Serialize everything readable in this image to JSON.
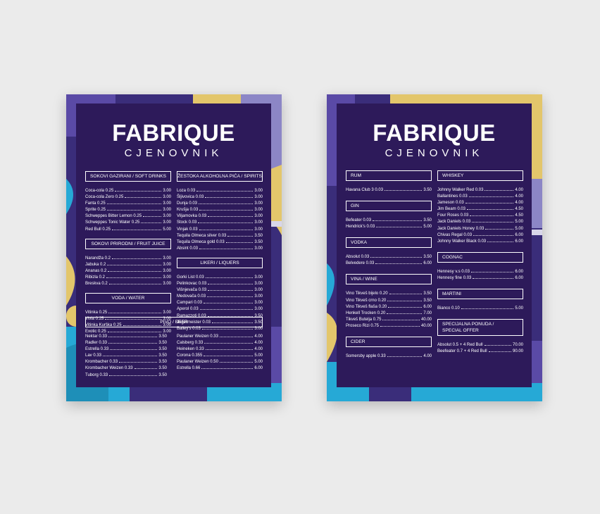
{
  "colors": {
    "background": "#ebebeb",
    "panel": "#2d1a5a",
    "purple": "#3a2d7a",
    "yellow": "#e3c66b",
    "blue": "#26a9d6",
    "lavender": "#8c86c6"
  },
  "left_menu": {
    "title": "FABRIQUE",
    "subtitle": "CJENOVNIK",
    "soft_drinks": {
      "header": "SOKOVI GAZIRANI / SOFT DRINKS",
      "items": [
        {
          "name": "Coca-cola 0.25",
          "price": "3.00"
        },
        {
          "name": "Coca-cola Zero 0.25",
          "price": "3.00"
        },
        {
          "name": "Fanta 0.25",
          "price": "3.00"
        },
        {
          "name": "Sprite 0.25",
          "price": "3.00"
        },
        {
          "name": "Schweppes Bitter Lemon 0.25",
          "price": "3.00"
        },
        {
          "name": "Schweppes Tonic Water 0.25",
          "price": "3.00"
        },
        {
          "name": "Red Bull 0.25",
          "price": "5.00"
        }
      ]
    },
    "fruit_juice": {
      "header": "SOKOVI PRIRODNI / FRUIT JUICE",
      "items": [
        {
          "name": "Narandža 0.2",
          "price": "3.00"
        },
        {
          "name": "Jabuka 0.2",
          "price": "3.00"
        },
        {
          "name": "Ananas 0.2",
          "price": "3.00"
        },
        {
          "name": "Ribizla 0.2",
          "price": "3.00"
        },
        {
          "name": "Breskva 0.2",
          "price": "3.00"
        }
      ]
    },
    "water": {
      "header": "VODA / WATER",
      "items": [
        {
          "name": "Vitinka 0.25",
          "price": "3.00"
        },
        {
          "name": "Vivia 0.25",
          "price": "3.00"
        },
        {
          "name": "Vitinka Kurška 0.25",
          "price": "3.00"
        },
        {
          "name": "Exotic 0.25",
          "price": "3.00"
        }
      ]
    },
    "spirits": {
      "header": "ŽESTOKA ALKOHOLNA PIĆA / SPIRITS",
      "items": [
        {
          "name": "Loza 0.03",
          "price": "3.00"
        },
        {
          "name": "Šljivovica 0.03",
          "price": "3.00"
        },
        {
          "name": "Dunja 0.03",
          "price": "3.00"
        },
        {
          "name": "Krušja 0.03",
          "price": "3.00"
        },
        {
          "name": "Viljamovka 0.03",
          "price": "3.00"
        },
        {
          "name": "Stock 0.03",
          "price": "3.00"
        },
        {
          "name": "Vinjak 0.03",
          "price": "3.00"
        },
        {
          "name": "Tequila Olmeca silver 0.03",
          "price": "3.50"
        },
        {
          "name": "Tequila Olmeca gold 0.03",
          "price": "3.50"
        },
        {
          "name": "Absint 0.03",
          "price": "3.00"
        }
      ]
    },
    "liqueurs": {
      "header": "LIKERI / LIQUERS",
      "items": [
        {
          "name": "Gorki List 0.03",
          "price": "3.00"
        },
        {
          "name": "Pelinkovac 0.03",
          "price": "3.00"
        },
        {
          "name": "Višnjevača 0.03",
          "price": "3.00"
        },
        {
          "name": "Medovača 0.03",
          "price": "3.00"
        },
        {
          "name": "Campari 0.03",
          "price": "3.00"
        },
        {
          "name": "Aperol 0.03",
          "price": "3.00"
        },
        {
          "name": "Ramazzoti 0.03",
          "price": "3.50"
        },
        {
          "name": "Jagermeister 0.03",
          "price": "3.50"
        },
        {
          "name": "Bailey's 0.03",
          "price": "3.00"
        }
      ]
    },
    "beer": {
      "header": "PIVO / BEER",
      "left_items": [
        {
          "name": "Nektar 0.33",
          "price": "3.50"
        },
        {
          "name": "Radler 0.33",
          "price": "3.50"
        },
        {
          "name": "Estrella 0.33",
          "price": "3.50"
        },
        {
          "name": "Lav 0.33",
          "price": "3.50"
        },
        {
          "name": "Krombacher 0.33",
          "price": "3.50"
        },
        {
          "name": "Krombacher Weizen 0.33",
          "price": "3.50"
        },
        {
          "name": "Tuborg 0.33",
          "price": "3.50"
        }
      ],
      "right_items": [
        {
          "name": "Paulaner Weizen 0.33",
          "price": "4.00"
        },
        {
          "name": "Calsberg 0.33",
          "price": "4.00"
        },
        {
          "name": "Heineken 0.33",
          "price": "4.00"
        },
        {
          "name": "Corona 0.355",
          "price": "5.00"
        },
        {
          "name": "Paulaner Weizen 0.50",
          "price": "5.00"
        },
        {
          "name": "Estrella 0.66",
          "price": "6.00"
        }
      ]
    }
  },
  "right_menu": {
    "title": "FABRIQUE",
    "subtitle": "CJENOVNIK",
    "rum": {
      "header": "RUM",
      "items": [
        {
          "name": "Havana Club 3  0.03",
          "price": "3.50"
        }
      ]
    },
    "gin": {
      "header": "GIN",
      "items": [
        {
          "name": "Befeater 0.03",
          "price": "3.50"
        },
        {
          "name": "Hendrick's 0.03",
          "price": "5.00"
        }
      ]
    },
    "vodka": {
      "header": "VODKA",
      "items": [
        {
          "name": "Absolut 0.03",
          "price": "3.50"
        },
        {
          "name": "Belvedere 0.03",
          "price": "6.00"
        }
      ]
    },
    "wine": {
      "header": "VINA / WINE",
      "items": [
        {
          "name": "Vino Tikveš bijelo 0.20",
          "price": "3.50"
        },
        {
          "name": "Vino Tikveš crno 0.20",
          "price": "3.50"
        },
        {
          "name": "Vino Tikveš flaša 0.20",
          "price": "6.00"
        },
        {
          "name": "Henkell Trocken  0.20",
          "price": "7.00"
        },
        {
          "name": "Tikveš Butelja 0.75",
          "price": "40.00"
        },
        {
          "name": "Proseco Rizi 0.75",
          "price": "40.00"
        }
      ]
    },
    "cider": {
      "header": "CIDER",
      "items": [
        {
          "name": "Somersby apple 0.33",
          "price": "4.00"
        }
      ]
    },
    "whiskey": {
      "header": "WHISKEY",
      "items": [
        {
          "name": "Johnny Walker Red 0.03",
          "price": "4.00"
        },
        {
          "name": "Ballantines 0.03",
          "price": "4.00"
        },
        {
          "name": "Jameson 0.03",
          "price": "4.00"
        },
        {
          "name": "Jim Beam 0.03",
          "price": "4.50"
        },
        {
          "name": "Four Roses 0.03",
          "price": "4.50"
        },
        {
          "name": "Jack Daniels 0.03",
          "price": "5.00"
        },
        {
          "name": "Jack Daniels Honey 0.03",
          "price": "5.00"
        },
        {
          "name": "Chivas Regal 0.03",
          "price": "6.00"
        },
        {
          "name": "Johnny Walker Black 0.03",
          "price": "6.00"
        }
      ]
    },
    "cognac": {
      "header": "COGNAC",
      "items": [
        {
          "name": "Hennesy v.s 0.03",
          "price": "6.00"
        },
        {
          "name": "Hennesy fine 0.03",
          "price": "6.00"
        }
      ]
    },
    "martini": {
      "header": "MARTINI",
      "items": [
        {
          "name": "Bianco 0.10",
          "price": "5.00"
        }
      ]
    },
    "special": {
      "header_line1": "SPECIJALNA PONUDA /",
      "header_line2": "SPECIAL OFFER",
      "items": [
        {
          "name": "Absolut 0.5 + 4 Red Bull",
          "price": "70.00"
        },
        {
          "name": "Beefeater 0.7 + 4 Red Bull",
          "price": "90.00"
        }
      ]
    }
  }
}
